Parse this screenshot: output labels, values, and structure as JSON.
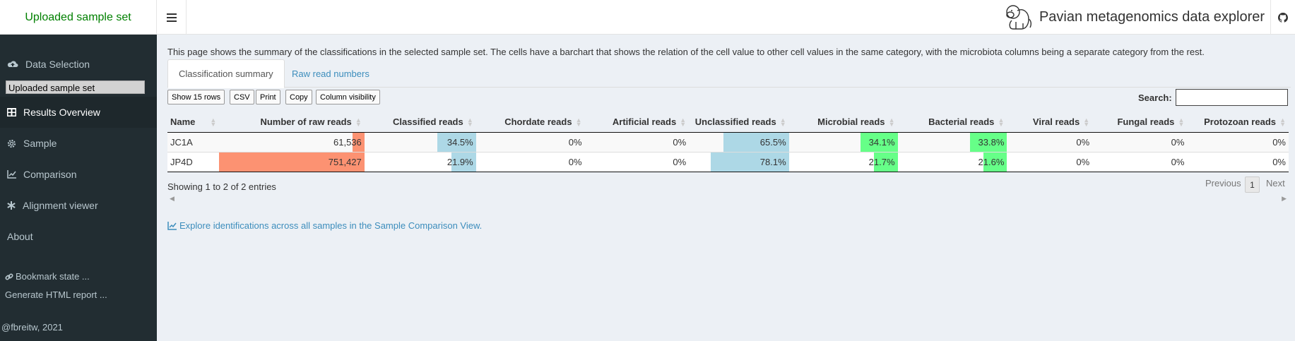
{
  "header": {
    "logo": "Uploaded sample set",
    "app_title": "Pavian metagenomics data explorer"
  },
  "sidebar": {
    "items": [
      {
        "label": "Data Selection",
        "icon": "cloud-upload-icon"
      },
      {
        "label": "Results Overview",
        "icon": "table-icon"
      },
      {
        "label": "Sample",
        "icon": "gear-icon"
      },
      {
        "label": "Comparison",
        "icon": "line-chart-icon"
      },
      {
        "label": "Alignment viewer",
        "icon": "asterisk-icon"
      },
      {
        "label": "About",
        "icon": ""
      }
    ],
    "sample_set": "Uploaded sample set",
    "bookmark": "Bookmark state ...",
    "report": "Generate HTML report ...",
    "footer": "@fbreitw, 2021"
  },
  "main": {
    "intro": "This page shows the summary of the classifications in the selected sample set. The cells have a barchart that shows the relation of the cell value to other cell values in the same category, with the microbiota columns being a separate category from the rest.",
    "tabs": [
      "Classification summary",
      "Raw read numbers"
    ],
    "buttons": [
      "Show 15 rows",
      "CSV",
      "Print",
      "Copy",
      "Column visibility"
    ],
    "search_label": "Search:",
    "columns": [
      "Name",
      "Number of raw reads",
      "Classified reads",
      "Chordate reads",
      "Artificial reads",
      "Unclassified reads",
      "Microbial reads",
      "Bacterial reads",
      "Viral reads",
      "Fungal reads",
      "Protozoan reads"
    ],
    "rows": [
      {
        "cells": [
          "JC1A",
          "61,536",
          "34.5%",
          "0%",
          "0%",
          "65.5%",
          "34.1%",
          "33.8%",
          "0%",
          "0%",
          "0%"
        ],
        "fractions": [
          0,
          0.082,
          0.345,
          0,
          0,
          0.655,
          0.341,
          0.338,
          0,
          0,
          0
        ]
      },
      {
        "cells": [
          "JP4D",
          "751,427",
          "21.9%",
          "0%",
          "0%",
          "78.1%",
          "21.7%",
          "21.6%",
          "0%",
          "0%",
          "0%"
        ],
        "fractions": [
          0,
          1.0,
          0.219,
          0,
          0,
          0.781,
          0.217,
          0.216,
          0,
          0,
          0
        ]
      }
    ],
    "bar_colors": [
      "",
      "#fc9272",
      "#add8e6",
      "#add8e6",
      "#add8e6",
      "#add8e6",
      "#66ff88",
      "#66ff88",
      "#66ff88",
      "#66ff88",
      "#66ff88"
    ],
    "info": "Showing 1 to 2 of 2 entries",
    "pager": {
      "previous": "Previous",
      "current": "1",
      "next": "Next"
    },
    "explore_link": "Explore identifications across all samples in the Sample Comparison View."
  }
}
